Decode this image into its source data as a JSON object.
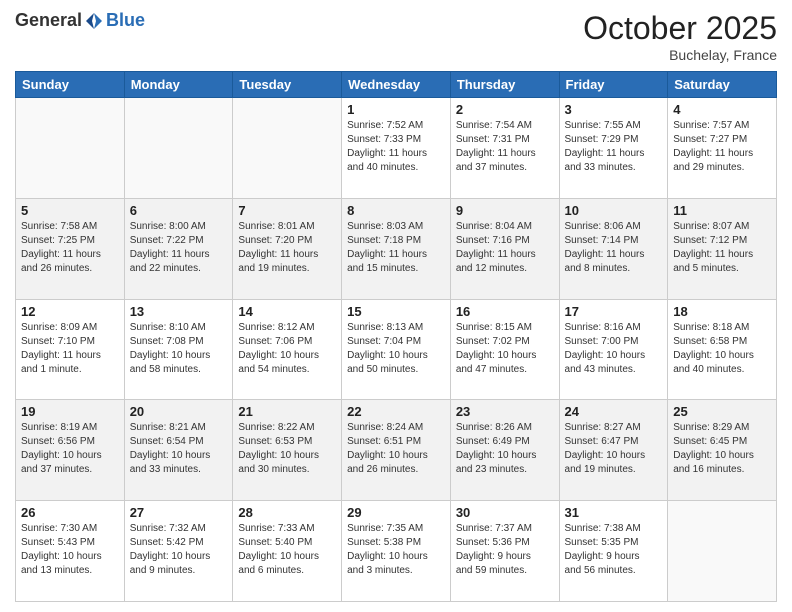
{
  "header": {
    "logo": {
      "part1": "General",
      "part2": "Blue"
    },
    "month": "October 2025",
    "location": "Buchelay, France"
  },
  "weekdays": [
    "Sunday",
    "Monday",
    "Tuesday",
    "Wednesday",
    "Thursday",
    "Friday",
    "Saturday"
  ],
  "weeks": [
    [
      {
        "day": "",
        "info": ""
      },
      {
        "day": "",
        "info": ""
      },
      {
        "day": "",
        "info": ""
      },
      {
        "day": "1",
        "info": "Sunrise: 7:52 AM\nSunset: 7:33 PM\nDaylight: 11 hours\nand 40 minutes."
      },
      {
        "day": "2",
        "info": "Sunrise: 7:54 AM\nSunset: 7:31 PM\nDaylight: 11 hours\nand 37 minutes."
      },
      {
        "day": "3",
        "info": "Sunrise: 7:55 AM\nSunset: 7:29 PM\nDaylight: 11 hours\nand 33 minutes."
      },
      {
        "day": "4",
        "info": "Sunrise: 7:57 AM\nSunset: 7:27 PM\nDaylight: 11 hours\nand 29 minutes."
      }
    ],
    [
      {
        "day": "5",
        "info": "Sunrise: 7:58 AM\nSunset: 7:25 PM\nDaylight: 11 hours\nand 26 minutes."
      },
      {
        "day": "6",
        "info": "Sunrise: 8:00 AM\nSunset: 7:22 PM\nDaylight: 11 hours\nand 22 minutes."
      },
      {
        "day": "7",
        "info": "Sunrise: 8:01 AM\nSunset: 7:20 PM\nDaylight: 11 hours\nand 19 minutes."
      },
      {
        "day": "8",
        "info": "Sunrise: 8:03 AM\nSunset: 7:18 PM\nDaylight: 11 hours\nand 15 minutes."
      },
      {
        "day": "9",
        "info": "Sunrise: 8:04 AM\nSunset: 7:16 PM\nDaylight: 11 hours\nand 12 minutes."
      },
      {
        "day": "10",
        "info": "Sunrise: 8:06 AM\nSunset: 7:14 PM\nDaylight: 11 hours\nand 8 minutes."
      },
      {
        "day": "11",
        "info": "Sunrise: 8:07 AM\nSunset: 7:12 PM\nDaylight: 11 hours\nand 5 minutes."
      }
    ],
    [
      {
        "day": "12",
        "info": "Sunrise: 8:09 AM\nSunset: 7:10 PM\nDaylight: 11 hours\nand 1 minute."
      },
      {
        "day": "13",
        "info": "Sunrise: 8:10 AM\nSunset: 7:08 PM\nDaylight: 10 hours\nand 58 minutes."
      },
      {
        "day": "14",
        "info": "Sunrise: 8:12 AM\nSunset: 7:06 PM\nDaylight: 10 hours\nand 54 minutes."
      },
      {
        "day": "15",
        "info": "Sunrise: 8:13 AM\nSunset: 7:04 PM\nDaylight: 10 hours\nand 50 minutes."
      },
      {
        "day": "16",
        "info": "Sunrise: 8:15 AM\nSunset: 7:02 PM\nDaylight: 10 hours\nand 47 minutes."
      },
      {
        "day": "17",
        "info": "Sunrise: 8:16 AM\nSunset: 7:00 PM\nDaylight: 10 hours\nand 43 minutes."
      },
      {
        "day": "18",
        "info": "Sunrise: 8:18 AM\nSunset: 6:58 PM\nDaylight: 10 hours\nand 40 minutes."
      }
    ],
    [
      {
        "day": "19",
        "info": "Sunrise: 8:19 AM\nSunset: 6:56 PM\nDaylight: 10 hours\nand 37 minutes."
      },
      {
        "day": "20",
        "info": "Sunrise: 8:21 AM\nSunset: 6:54 PM\nDaylight: 10 hours\nand 33 minutes."
      },
      {
        "day": "21",
        "info": "Sunrise: 8:22 AM\nSunset: 6:53 PM\nDaylight: 10 hours\nand 30 minutes."
      },
      {
        "day": "22",
        "info": "Sunrise: 8:24 AM\nSunset: 6:51 PM\nDaylight: 10 hours\nand 26 minutes."
      },
      {
        "day": "23",
        "info": "Sunrise: 8:26 AM\nSunset: 6:49 PM\nDaylight: 10 hours\nand 23 minutes."
      },
      {
        "day": "24",
        "info": "Sunrise: 8:27 AM\nSunset: 6:47 PM\nDaylight: 10 hours\nand 19 minutes."
      },
      {
        "day": "25",
        "info": "Sunrise: 8:29 AM\nSunset: 6:45 PM\nDaylight: 10 hours\nand 16 minutes."
      }
    ],
    [
      {
        "day": "26",
        "info": "Sunrise: 7:30 AM\nSunset: 5:43 PM\nDaylight: 10 hours\nand 13 minutes."
      },
      {
        "day": "27",
        "info": "Sunrise: 7:32 AM\nSunset: 5:42 PM\nDaylight: 10 hours\nand 9 minutes."
      },
      {
        "day": "28",
        "info": "Sunrise: 7:33 AM\nSunset: 5:40 PM\nDaylight: 10 hours\nand 6 minutes."
      },
      {
        "day": "29",
        "info": "Sunrise: 7:35 AM\nSunset: 5:38 PM\nDaylight: 10 hours\nand 3 minutes."
      },
      {
        "day": "30",
        "info": "Sunrise: 7:37 AM\nSunset: 5:36 PM\nDaylight: 9 hours\nand 59 minutes."
      },
      {
        "day": "31",
        "info": "Sunrise: 7:38 AM\nSunset: 5:35 PM\nDaylight: 9 hours\nand 56 minutes."
      },
      {
        "day": "",
        "info": ""
      }
    ]
  ]
}
